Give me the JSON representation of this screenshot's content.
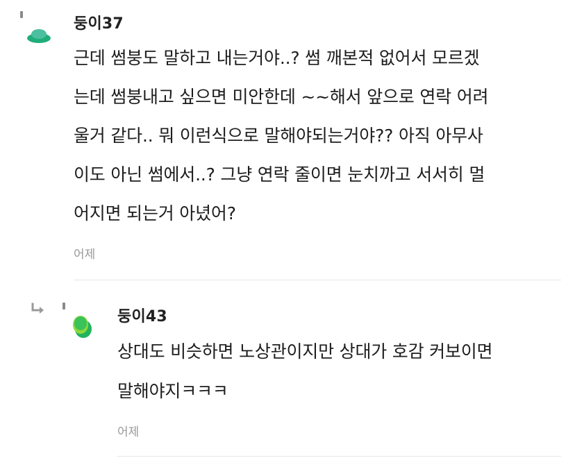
{
  "comments": [
    {
      "username": "둥이37",
      "time": "어제",
      "avatar_colors": [
        "#4bbf9f",
        "#1fae7a"
      ],
      "lines": [
        "근데 썸붕도 말하고 내는거야..? 썸 깨본적 없어서 모르겠",
        "는데 썸붕내고 싶으면 미안한데 ~~해서 앞으로 연락 어려",
        "울거 같다.. 뭐 이런식으로 말해야되는거야?? 아직 아무사",
        "이도 아닌 썸에서..? 그냥 연락 줄이면 눈치까고 서서히 멀",
        "어지면 되는거 아녔어?"
      ]
    },
    {
      "username": "둥이43",
      "time": "어제",
      "avatar_colors": [
        "#8fd93a",
        "#22b35e"
      ],
      "lines": [
        "상대도 비슷하면 노상관이지만 상대가 호감 커보이면",
        "말해야지ㅋㅋㅋ"
      ]
    }
  ],
  "icons": {
    "reply": "reply-arrow-icon",
    "menu": "more-menu-icon"
  }
}
